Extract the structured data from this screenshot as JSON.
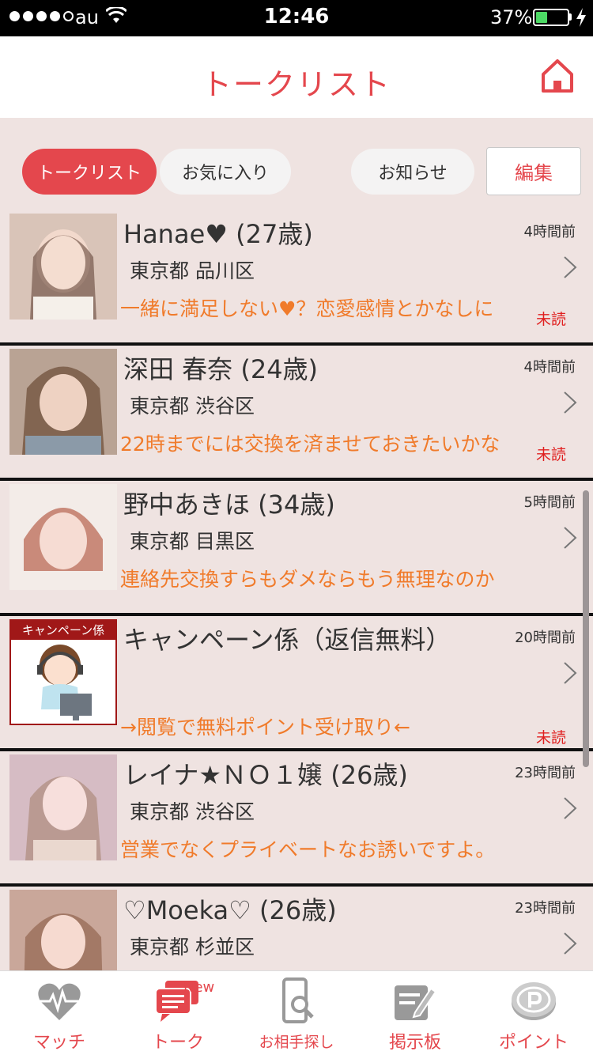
{
  "status_bar": {
    "carrier": "au",
    "time": "12:46",
    "battery_percent": "37%",
    "battery_level": 0.37,
    "signal_filled": 4,
    "signal_total": 5
  },
  "header": {
    "title": "トークリスト",
    "home_icon": "home-icon"
  },
  "tabs": {
    "talk_list": "トークリスト",
    "favorites": "お気に入り",
    "notices": "お知らせ",
    "edit": "編集"
  },
  "conversations": [
    {
      "name": "Hanae♥ (27歳)",
      "time": "4時間前",
      "location": "東京都 品川区",
      "message": "一緒に満足しない♥？恋愛感情とかなしに",
      "unread": "未読",
      "avatar_color": "#d9c4b8"
    },
    {
      "name": "深田 春奈 (24歳)",
      "time": "4時間前",
      "location": "東京都 渋谷区",
      "message": "22時までには交換を済ませておきたいかな",
      "unread": "未読",
      "avatar_color": "#b9a394"
    },
    {
      "name": "野中あきほ (34歳)",
      "time": "5時間前",
      "location": "東京都 目黒区",
      "message": "連絡先交換すらもダメならもう無理なのか",
      "unread": "",
      "avatar_color": "#c98a7a"
    },
    {
      "name": "キャンペーン係（返信無料）",
      "time": "20時間前",
      "location": "",
      "message": "→閲覧で無料ポイント受け取り←",
      "unread": "未読",
      "campaign_label": "キャンペーン係",
      "avatar_color": "#ffffff"
    },
    {
      "name": "レイナ★ＮＯ１嬢 (26歳)",
      "time": "23時間前",
      "location": "東京都 渋谷区",
      "message": "営業でなくプライベートなお誘いですよ。",
      "unread": "",
      "avatar_color": "#d6bcc4"
    },
    {
      "name": "♡Moeka♡ (26歳)",
      "time": "23時間前",
      "location": "東京都 杉並区",
      "message": "",
      "unread": "",
      "avatar_color": "#c9a79a"
    }
  ],
  "bottom_nav": {
    "items": [
      {
        "label": "マッチ",
        "icon": "heart-pulse-icon"
      },
      {
        "label": "トーク",
        "icon": "chat-icon",
        "badge": "New"
      },
      {
        "label": "お相手探し",
        "icon": "phone-search-icon"
      },
      {
        "label": "掲示板",
        "icon": "board-icon"
      },
      {
        "label": "ポイント",
        "icon": "point-coin-icon"
      }
    ]
  },
  "colors": {
    "accent": "#e4474d",
    "message": "#f07b2b",
    "unread": "#e02020",
    "background": "#efe3e1"
  }
}
